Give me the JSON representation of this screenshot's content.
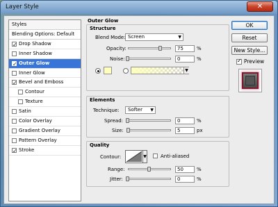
{
  "window": {
    "title": "Layer Style",
    "close_glyph": "✕"
  },
  "sidebar": {
    "header": "Styles",
    "blending_options": "Blending Options: Default",
    "items": [
      {
        "label": "Drop Shadow",
        "checked": true,
        "indent": false,
        "selected": false
      },
      {
        "label": "Inner Shadow",
        "checked": false,
        "indent": false,
        "selected": false
      },
      {
        "label": "Outer Glow",
        "checked": true,
        "indent": false,
        "selected": true
      },
      {
        "label": "Inner Glow",
        "checked": false,
        "indent": false,
        "selected": false
      },
      {
        "label": "Bevel and Emboss",
        "checked": true,
        "indent": false,
        "selected": false
      },
      {
        "label": "Contour",
        "checked": false,
        "indent": true,
        "selected": false
      },
      {
        "label": "Texture",
        "checked": false,
        "indent": true,
        "selected": false
      },
      {
        "label": "Satin",
        "checked": false,
        "indent": false,
        "selected": false
      },
      {
        "label": "Color Overlay",
        "checked": false,
        "indent": false,
        "selected": false
      },
      {
        "label": "Gradient Overlay",
        "checked": false,
        "indent": false,
        "selected": false
      },
      {
        "label": "Pattern Overlay",
        "checked": false,
        "indent": false,
        "selected": false
      },
      {
        "label": "Stroke",
        "checked": true,
        "indent": false,
        "selected": false
      }
    ]
  },
  "main": {
    "title": "Outer Glow",
    "structure": {
      "label": "Structure",
      "blend_mode_label": "Blend Mode:",
      "blend_mode_value": "Screen",
      "opacity_label": "Opacity:",
      "opacity_value": "75",
      "opacity_level": 0.75,
      "noise_label": "Noise:",
      "noise_value": "0",
      "noise_level": 0,
      "percent": "%",
      "color_mode": "solid",
      "color": "#ffffbe"
    },
    "elements": {
      "label": "Elements",
      "technique_label": "Technique:",
      "technique_value": "Softer",
      "spread_label": "Spread:",
      "spread_value": "0",
      "spread_level": 0,
      "size_label": "Size:",
      "size_value": "5",
      "size_level": 0.02,
      "percent": "%",
      "px": "px"
    },
    "quality": {
      "label": "Quality",
      "contour_label": "Contour:",
      "anti_aliased_label": "Anti-aliased",
      "anti_aliased": false,
      "range_label": "Range:",
      "range_value": "50",
      "range_level": 0.5,
      "jitter_label": "Jitter:",
      "jitter_value": "0",
      "jitter_level": 0,
      "percent": "%"
    }
  },
  "buttons": {
    "ok": "OK",
    "reset": "Reset",
    "new_style": "New Style...",
    "preview_label": "Preview",
    "preview_checked": true
  }
}
